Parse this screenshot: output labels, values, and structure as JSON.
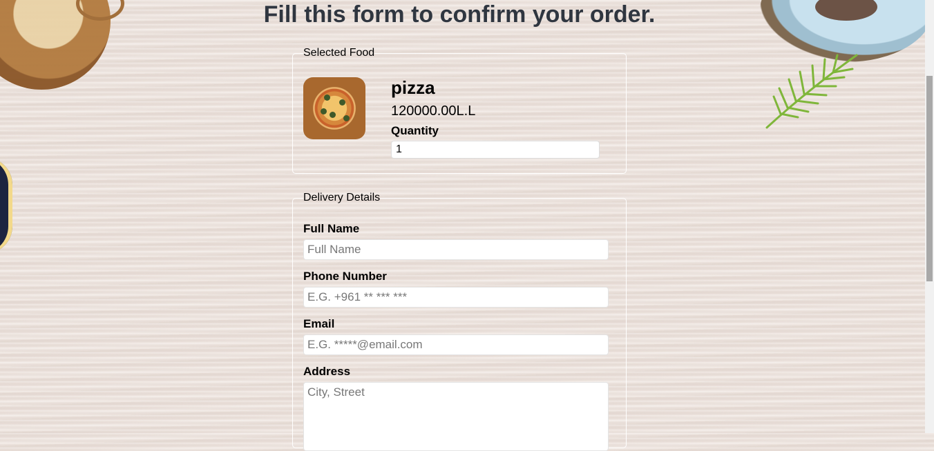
{
  "page": {
    "title": "Fill this form to confirm your order."
  },
  "selected_food": {
    "legend": "Selected Food",
    "name": "pizza",
    "price": "120000.00L.L",
    "quantity_label": "Quantity",
    "quantity_value": "1"
  },
  "delivery": {
    "legend": "Delivery Details",
    "full_name": {
      "label": "Full Name",
      "placeholder": "Full Name"
    },
    "phone": {
      "label": "Phone Number",
      "placeholder": "E.G. +961 ** *** ***"
    },
    "email": {
      "label": "Email",
      "placeholder": "E.G. *****@email.com"
    },
    "address": {
      "label": "Address",
      "placeholder": "City, Street"
    }
  },
  "colors": {
    "title": "#2f3640",
    "background": "#ece2dc",
    "fieldset_border": "#ffffff"
  },
  "icons": {
    "food_image": "pizza-image"
  }
}
